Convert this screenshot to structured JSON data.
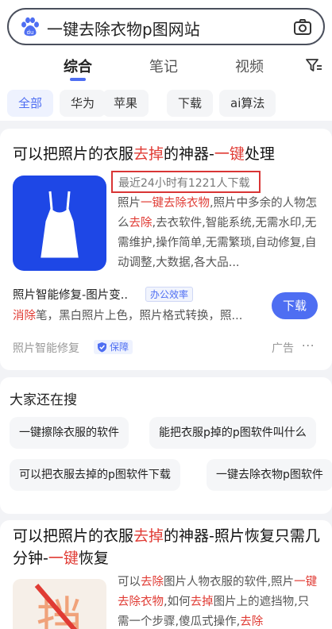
{
  "search": {
    "query": "一键去除衣物p图网站"
  },
  "tabs": [
    {
      "label": "综合"
    },
    {
      "label": "笔记"
    },
    {
      "label": "视频"
    }
  ],
  "chips": [
    {
      "label": "全部"
    },
    {
      "label": "华为"
    },
    {
      "label": "苹果"
    },
    {
      "label": "下载"
    },
    {
      "label": "ai算法"
    }
  ],
  "result1": {
    "title_a": "可以把照片的衣服",
    "title_hl1": "去掉",
    "title_b": "的神器-",
    "title_hl2": "一键",
    "title_c": "处理",
    "download_stat": "最近24小时有1221人下载",
    "desc_a": "照片",
    "desc_hl1": "一键去除衣物",
    "desc_b": ",照片中多余的人物怎么",
    "desc_hl2": "去除",
    "desc_c": ",去衣软件,智能系统,无需水印,无需维护,操作简单,无需繁琐,自动修复,自动调整,大数据,各大品...",
    "app_name": "照片智能修复-图片变..",
    "badge": "办公效率",
    "sub_hl": "消除",
    "sub_rest": "笔，黑白照片上色，照片格式转换，照...",
    "download_button": "下载",
    "source": "照片智能修复",
    "shield_label": "保障",
    "ad_label": "广告",
    "more": "···"
  },
  "related": {
    "title": "大家还在搜",
    "items": [
      {
        "label": "一键擦除衣服的软件"
      },
      {
        "label": "能把衣服p掉的p图软件叫什么"
      },
      {
        "label": "可以把衣服去掉的p图软件下载"
      },
      {
        "label": "一键去除衣物p图软件"
      }
    ]
  },
  "result2": {
    "title_a": "可以把照片的衣服",
    "title_hl1": "去掉",
    "title_b": "的神器-照片恢复只需几分钟-",
    "title_hl2": "一键",
    "title_c": "恢复",
    "desc_a": "可以",
    "desc_hl1": "去除",
    "desc_b": "图片人物衣服的软件,照片",
    "desc_hl2": "一键去除衣物",
    "desc_c": ",如何",
    "desc_hl3": "去掉",
    "desc_d": "图片上的遮挡物,只需一个步骤,傻瓜式操作,",
    "desc_hl4": "去除",
    "thumb_char": "挡"
  },
  "colors": {
    "accent": "#4e6ef2",
    "highlight": "#e03b34",
    "app_icon": "#1e47e6"
  }
}
